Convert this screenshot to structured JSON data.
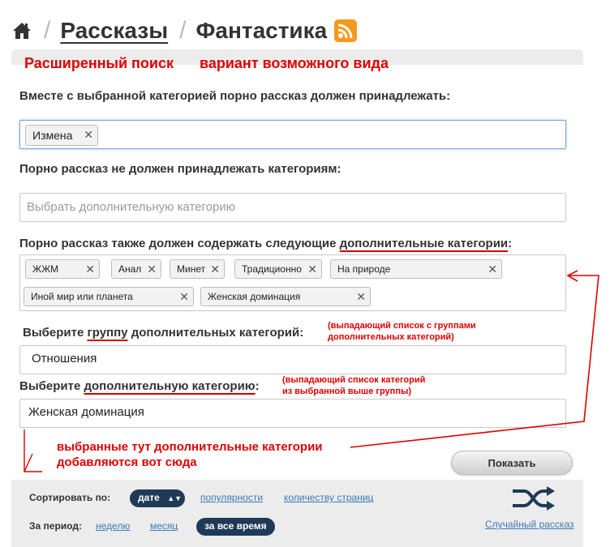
{
  "header": {
    "crumbs": [
      "Рассказы",
      "Фантастика"
    ],
    "separator": "/"
  },
  "panel": {
    "title": "Расширенный поиск",
    "subtitle": "вариант возможного вида"
  },
  "include": {
    "label": "Вместе с выбранной категорией порно рассказ должен принадлежать:",
    "tags": [
      "Измена"
    ]
  },
  "exclude": {
    "label": "Порно рассказ не должен принадлежать категориям:",
    "placeholder": "Выбрать дополнительную категорию"
  },
  "extra": {
    "label_prefix": "Порно рассказ также должен содержать следующие ",
    "label_link": "дополнительные категории",
    "label_suffix": ":",
    "tags": [
      "ЖЖМ",
      "Анал",
      "Минет",
      "Традиционно",
      "На природе",
      "Иной мир или планета",
      "Женская доминация"
    ]
  },
  "group_select": {
    "label_prefix": "Выберите ",
    "label_link": "группу",
    "label_suffix": " дополнительных категорий:",
    "note_line1": "(выпадающий список с группами",
    "note_line2": "дополнительных категорий)",
    "value": "Отношения"
  },
  "category_select": {
    "label_prefix": "Выберите ",
    "label_link": "дополнительную категорию",
    "label_suffix": ":",
    "note_line1": "(выпадающий список категорий",
    "note_line2": "из выбранной выше группы)",
    "value": "Женская доминация"
  },
  "annotation": {
    "line1": "выбранные тут дополнительные категории",
    "line2": "добавляются вот сюда"
  },
  "show_button": "Показать",
  "sort": {
    "label": "Сортировать по:",
    "active": "дате",
    "options": [
      "популярности",
      "количеству страниц"
    ]
  },
  "period": {
    "label": "За период:",
    "options": [
      "неделю",
      "месяц"
    ],
    "active": "за все время"
  },
  "random_link": "Случайный рассказ",
  "colors": {
    "accent_red": "#e00000",
    "pill_dark": "#1f3a56",
    "link_blue": "#3a7ab8",
    "panel_gray": "#ececec",
    "rss_orange": "#f39a1e"
  }
}
